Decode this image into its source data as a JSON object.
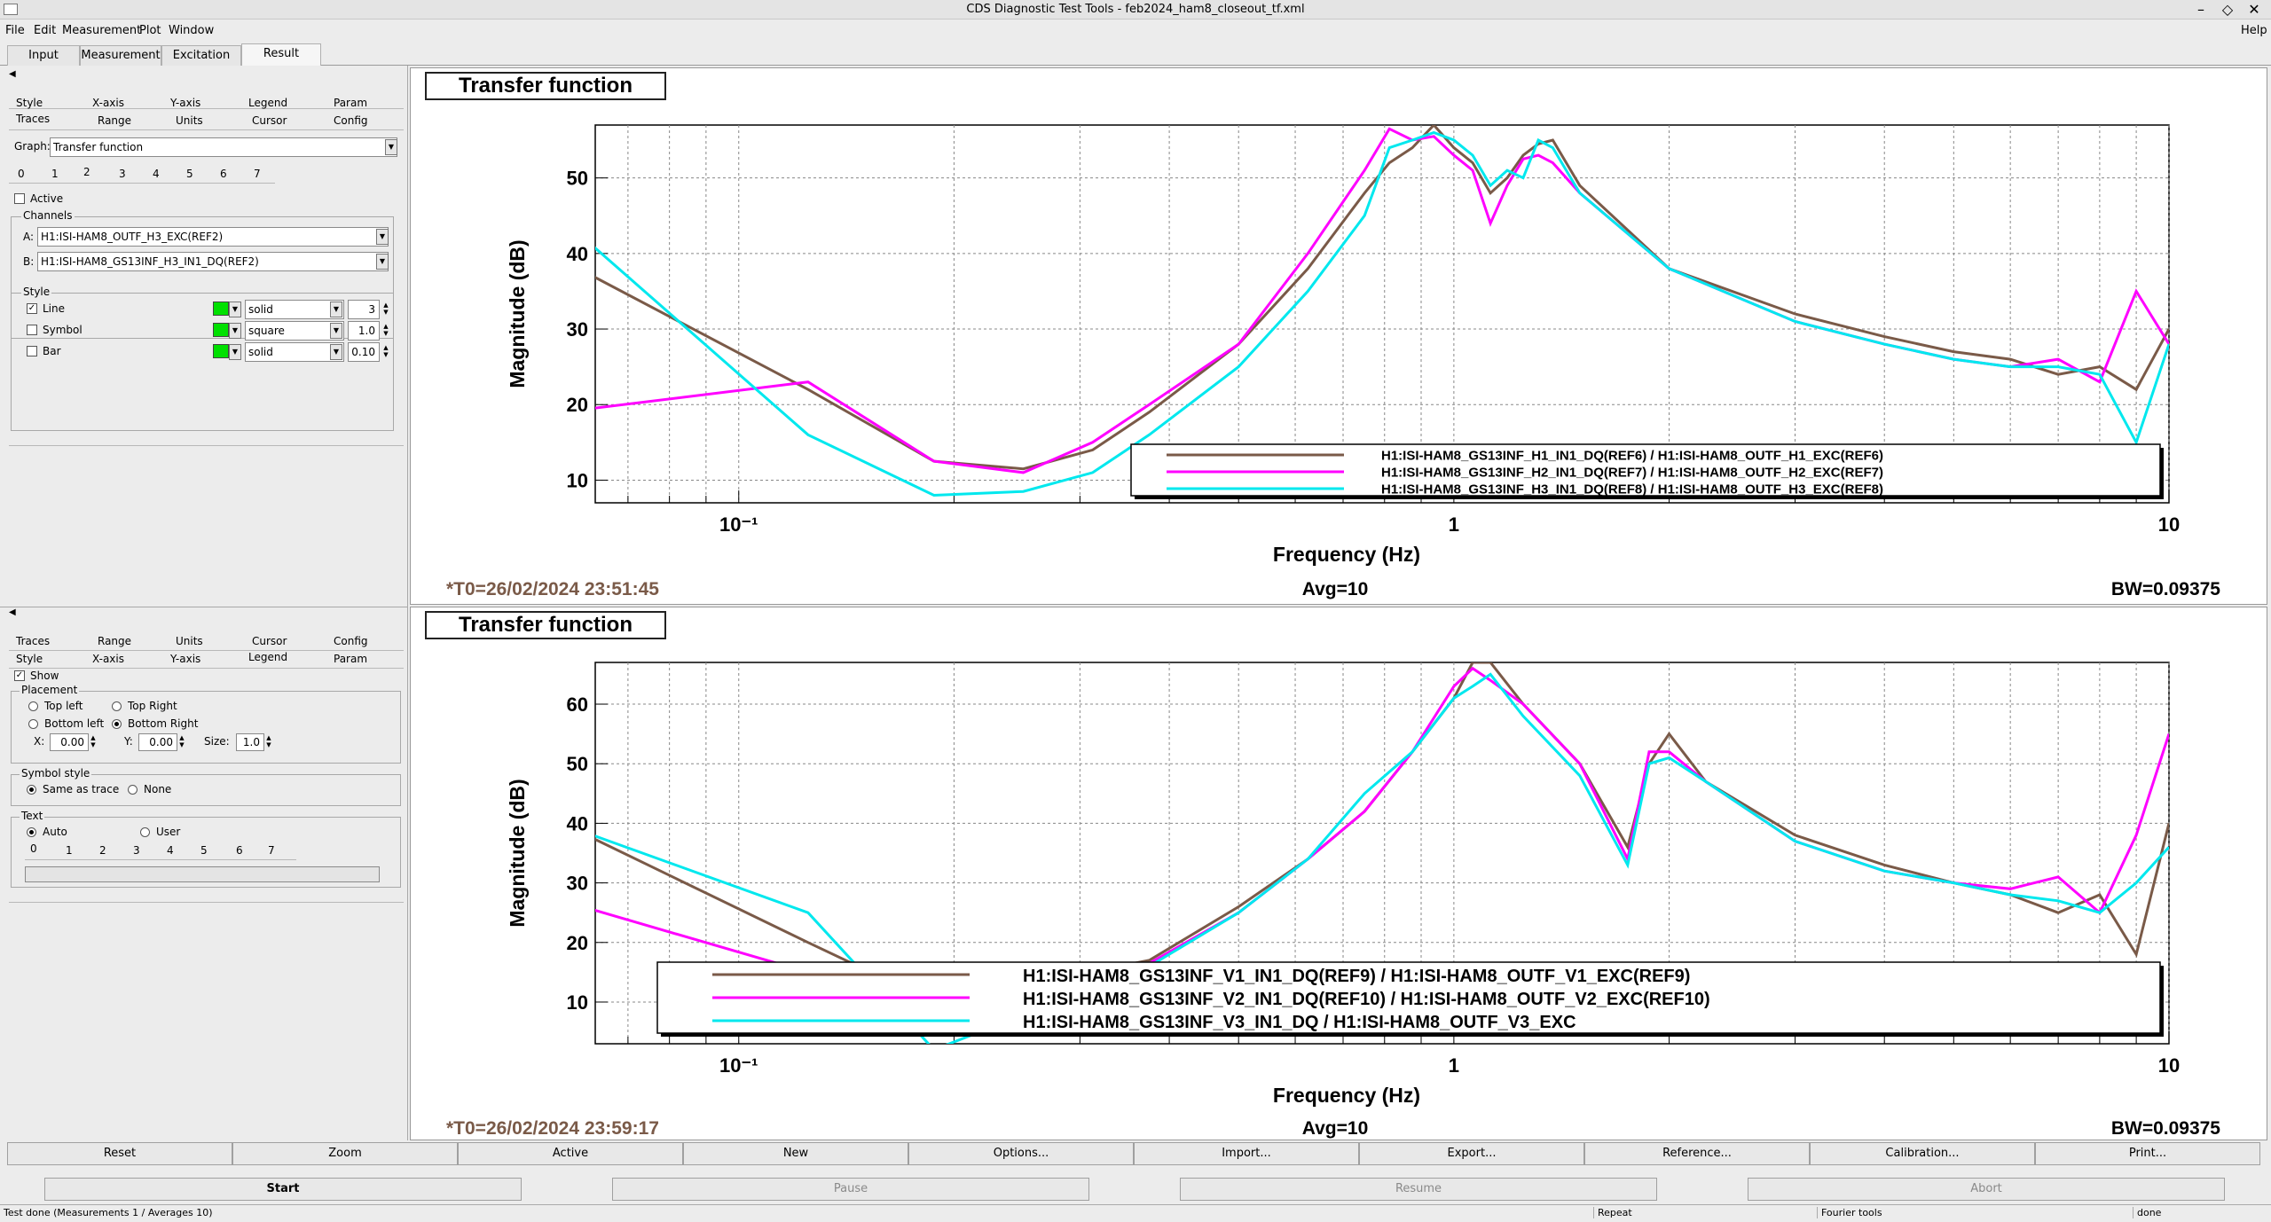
{
  "window": {
    "title": "CDS Diagnostic Test Tools - feb2024_ham8_closeout_tf.xml"
  },
  "menu": {
    "file": "File",
    "edit": "Edit",
    "measurement": "Measurement",
    "plot": "Plot",
    "window": "Window",
    "help": "Help"
  },
  "main_tabs": [
    "Input",
    "Measurement",
    "Excitation",
    "Result"
  ],
  "top_panel": {
    "tabs_row1": [
      "Style",
      "X-axis",
      "Y-axis",
      "Legend",
      "Param"
    ],
    "tabs_row2": [
      "Traces",
      "Range",
      "Units",
      "Cursor",
      "Config"
    ],
    "graph_label": "Graph:",
    "graph_value": "Transfer function",
    "trace_tabs": [
      "0",
      "1",
      "2",
      "3",
      "4",
      "5",
      "6",
      "7"
    ],
    "active_label": "Active",
    "channels_label": "Channels",
    "channel_a_label": "A:",
    "channel_a": "H1:ISI-HAM8_OUTF_H3_EXC(REF2)",
    "channel_b_label": "B:",
    "channel_b": "H1:ISI-HAM8_GS13INF_H3_IN1_DQ(REF2)",
    "style_label": "Style",
    "line_label": "Line",
    "line_style": "solid",
    "line_width": "3",
    "symbol_label": "Symbol",
    "symbol_style": "square",
    "symbol_size": "1.0",
    "bar_label": "Bar",
    "bar_style": "solid",
    "bar_width": "0.10"
  },
  "bottom_panel": {
    "tabs_row1": [
      "Traces",
      "Range",
      "Units",
      "Cursor",
      "Config"
    ],
    "tabs_row2": [
      "Style",
      "X-axis",
      "Y-axis",
      "Legend",
      "Param"
    ],
    "show_label": "Show",
    "placement_label": "Placement",
    "top_left": "Top left",
    "top_right": "Top Right",
    "bottom_left": "Bottom left",
    "bottom_right": "Bottom Right",
    "x_label": "X:",
    "x_value": "0.00",
    "y_label": "Y:",
    "y_value": "0.00",
    "size_label": "Size:",
    "size_value": "1.0",
    "symbol_style_label": "Symbol style",
    "same_as_trace": "Same as trace",
    "none": "None",
    "text_label": "Text",
    "auto": "Auto",
    "user": "User",
    "text_tabs": [
      "0",
      "1",
      "2",
      "3",
      "4",
      "5",
      "6",
      "7"
    ]
  },
  "graph_top": {
    "title": "Transfer function",
    "ylabel": "Magnitude (dB)",
    "xlabel": "Frequency (Hz)",
    "t0": "*T0=26/02/2024 23:51:45",
    "avg": "Avg=10",
    "bw": "BW=0.09375",
    "yticks": [
      "10",
      "20",
      "30",
      "40",
      "50"
    ],
    "xticks": [
      "10⁻¹",
      "1",
      "10"
    ],
    "legend": [
      "H1:ISI-HAM8_GS13INF_H1_IN1_DQ(REF6) / H1:ISI-HAM8_OUTF_H1_EXC(REF6)",
      "H1:ISI-HAM8_GS13INF_H2_IN1_DQ(REF7) / H1:ISI-HAM8_OUTF_H2_EXC(REF7)",
      "H1:ISI-HAM8_GS13INF_H3_IN1_DQ(REF8) / H1:ISI-HAM8_OUTF_H3_EXC(REF8)"
    ]
  },
  "graph_bottom": {
    "title": "Transfer function",
    "ylabel": "Magnitude (dB)",
    "xlabel": "Frequency (Hz)",
    "t0": "*T0=26/02/2024 23:59:17",
    "avg": "Avg=10",
    "bw": "BW=0.09375",
    "yticks": [
      "10",
      "20",
      "30",
      "40",
      "50",
      "60"
    ],
    "xticks": [
      "10⁻¹",
      "1",
      "10"
    ],
    "legend": [
      "H1:ISI-HAM8_GS13INF_V1_IN1_DQ(REF9) / H1:ISI-HAM8_OUTF_V1_EXC(REF9)",
      "H1:ISI-HAM8_GS13INF_V2_IN1_DQ(REF10) / H1:ISI-HAM8_OUTF_V2_EXC(REF10)",
      "H1:ISI-HAM8_GS13INF_V3_IN1_DQ / H1:ISI-HAM8_OUTF_V3_EXC"
    ]
  },
  "buttons1": [
    "Reset",
    "Zoom",
    "Active",
    "New",
    "Options...",
    "Import...",
    "Export...",
    "Reference...",
    "Calibration...",
    "Print..."
  ],
  "buttons2": [
    "Start",
    "Pause",
    "Resume",
    "Abort"
  ],
  "status": {
    "text": "Test done (Measurements 1 / Averages 10)",
    "repeat": "Repeat",
    "fourier": "Fourier tools",
    "done": "done"
  },
  "colors": {
    "brown": "#7a5a48",
    "magenta": "#ff00ff",
    "cyan": "#00e8ee",
    "swatch": "#00e000"
  },
  "chart_data": [
    {
      "type": "line",
      "title": "Transfer function",
      "xlabel": "Frequency (Hz)",
      "ylabel": "Magnitude (dB)",
      "xscale": "log",
      "xlim": [
        0.063,
        10
      ],
      "ylim": [
        7,
        57
      ],
      "grid": true,
      "legend_position": "bottom-right",
      "series": [
        {
          "name": "H1:ISI-HAM8_GS13INF_H1_IN1_DQ(REF6) / H1:ISI-HAM8_OUTF_H1_EXC(REF6)",
          "color": "#7a5a48",
          "x": [
            0.0625,
            0.125,
            0.1875,
            0.25,
            0.3125,
            0.375,
            0.5,
            0.625,
            0.75,
            0.8125,
            0.875,
            0.9375,
            1.0,
            1.0625,
            1.125,
            1.1875,
            1.25,
            1.3125,
            1.375,
            1.5,
            2.0,
            3.0,
            4.0,
            5.0,
            6.0,
            7.0,
            8.0,
            9.0,
            10.0
          ],
          "y": [
            37,
            22,
            12.5,
            11.5,
            14,
            19,
            28,
            38,
            48,
            52,
            54,
            57,
            54,
            52,
            48,
            50,
            53,
            54.5,
            55,
            49,
            38,
            32,
            29,
            27,
            26,
            24,
            25,
            22,
            30
          ]
        },
        {
          "name": "H1:ISI-HAM8_GS13INF_H2_IN1_DQ(REF7) / H1:ISI-HAM8_OUTF_H2_EXC(REF7)",
          "color": "#ff00ff",
          "x": [
            0.0625,
            0.125,
            0.1875,
            0.25,
            0.3125,
            0.375,
            0.5,
            0.625,
            0.75,
            0.8125,
            0.875,
            0.9375,
            1.0,
            1.0625,
            1.125,
            1.1875,
            1.25,
            1.3125,
            1.375,
            1.5,
            2.0,
            3.0,
            4.0,
            5.0,
            6.0,
            7.0,
            8.0,
            9.0,
            10.0
          ],
          "y": [
            19.5,
            23,
            12.5,
            11,
            15,
            20,
            28,
            40,
            51,
            56.5,
            55,
            55.5,
            53,
            51,
            44,
            49,
            52.5,
            53,
            52,
            48,
            38,
            31,
            28,
            26,
            25,
            26,
            23,
            35,
            28
          ]
        },
        {
          "name": "H1:ISI-HAM8_GS13INF_H3_IN1_DQ(REF8) / H1:ISI-HAM8_OUTF_H3_EXC(REF8)",
          "color": "#00e8ee",
          "x": [
            0.0625,
            0.125,
            0.1875,
            0.25,
            0.3125,
            0.375,
            0.5,
            0.625,
            0.75,
            0.8125,
            0.875,
            0.9375,
            1.0,
            1.0625,
            1.125,
            1.1875,
            1.25,
            1.3125,
            1.375,
            1.5,
            2.0,
            3.0,
            4.0,
            5.0,
            6.0,
            7.0,
            8.0,
            9.0,
            10.0
          ],
          "y": [
            41,
            16,
            8,
            8.5,
            11,
            16,
            25,
            35,
            45,
            54,
            55,
            56,
            55,
            53,
            49,
            51,
            50,
            55,
            54,
            48,
            38,
            31,
            28,
            26,
            25,
            25,
            24,
            15,
            28
          ]
        }
      ]
    },
    {
      "type": "line",
      "title": "Transfer function",
      "xlabel": "Frequency (Hz)",
      "ylabel": "Magnitude (dB)",
      "xscale": "log",
      "xlim": [
        0.063,
        10
      ],
      "ylim": [
        3,
        67
      ],
      "grid": true,
      "legend_position": "bottom-right",
      "series": [
        {
          "name": "H1:ISI-HAM8_GS13INF_V1_IN1_DQ(REF9) / H1:ISI-HAM8_OUTF_V1_EXC(REF9)",
          "color": "#7a5a48",
          "x": [
            0.0625,
            0.125,
            0.1875,
            0.375,
            0.5,
            0.625,
            0.75,
            0.875,
            1.0,
            1.0625,
            1.125,
            1.25,
            1.5,
            1.75,
            1.875,
            2.0,
            2.25,
            3.0,
            4.0,
            5.0,
            6.0,
            7.0,
            8.0,
            9.0,
            10.0
          ],
          "y": [
            37.5,
            20,
            10,
            17,
            26,
            34,
            42,
            52,
            61,
            67,
            67,
            60,
            50,
            36,
            50,
            55,
            47,
            38,
            33,
            30,
            28,
            25,
            28,
            18,
            40
          ]
        },
        {
          "name": "H1:ISI-HAM8_GS13INF_V2_IN1_DQ(REF10) / H1:ISI-HAM8_OUTF_V2_EXC(REF10)",
          "color": "#ff00ff",
          "x": [
            0.0625,
            0.125,
            0.1875,
            0.375,
            0.5,
            0.625,
            0.75,
            0.875,
            1.0,
            1.0625,
            1.125,
            1.25,
            1.5,
            1.75,
            1.875,
            2.0,
            2.25,
            3.0,
            4.0,
            5.0,
            6.0,
            7.0,
            8.0,
            9.0,
            10.0
          ],
          "y": [
            25.5,
            15,
            10,
            16.5,
            25,
            34,
            42,
            52,
            63,
            66,
            64,
            60,
            50,
            34,
            52,
            52,
            47,
            37,
            32,
            30,
            29,
            31,
            25,
            38,
            55
          ]
        },
        {
          "name": "H1:ISI-HAM8_GS13INF_V3_IN1_DQ / H1:ISI-HAM8_OUTF_V3_EXC",
          "color": "#00e8ee",
          "x": [
            0.0625,
            0.125,
            0.1875,
            0.375,
            0.5,
            0.625,
            0.75,
            0.875,
            1.0,
            1.0625,
            1.125,
            1.25,
            1.5,
            1.75,
            1.875,
            2.0,
            2.25,
            3.0,
            4.0,
            5.0,
            6.0,
            7.0,
            8.0,
            9.0,
            10.0
          ],
          "y": [
            38,
            25,
            2,
            16,
            25,
            34,
            45,
            52,
            61,
            63,
            65,
            58,
            48,
            33,
            50,
            51,
            47,
            37,
            32,
            30,
            28,
            27,
            25,
            30,
            36
          ]
        }
      ]
    }
  ]
}
